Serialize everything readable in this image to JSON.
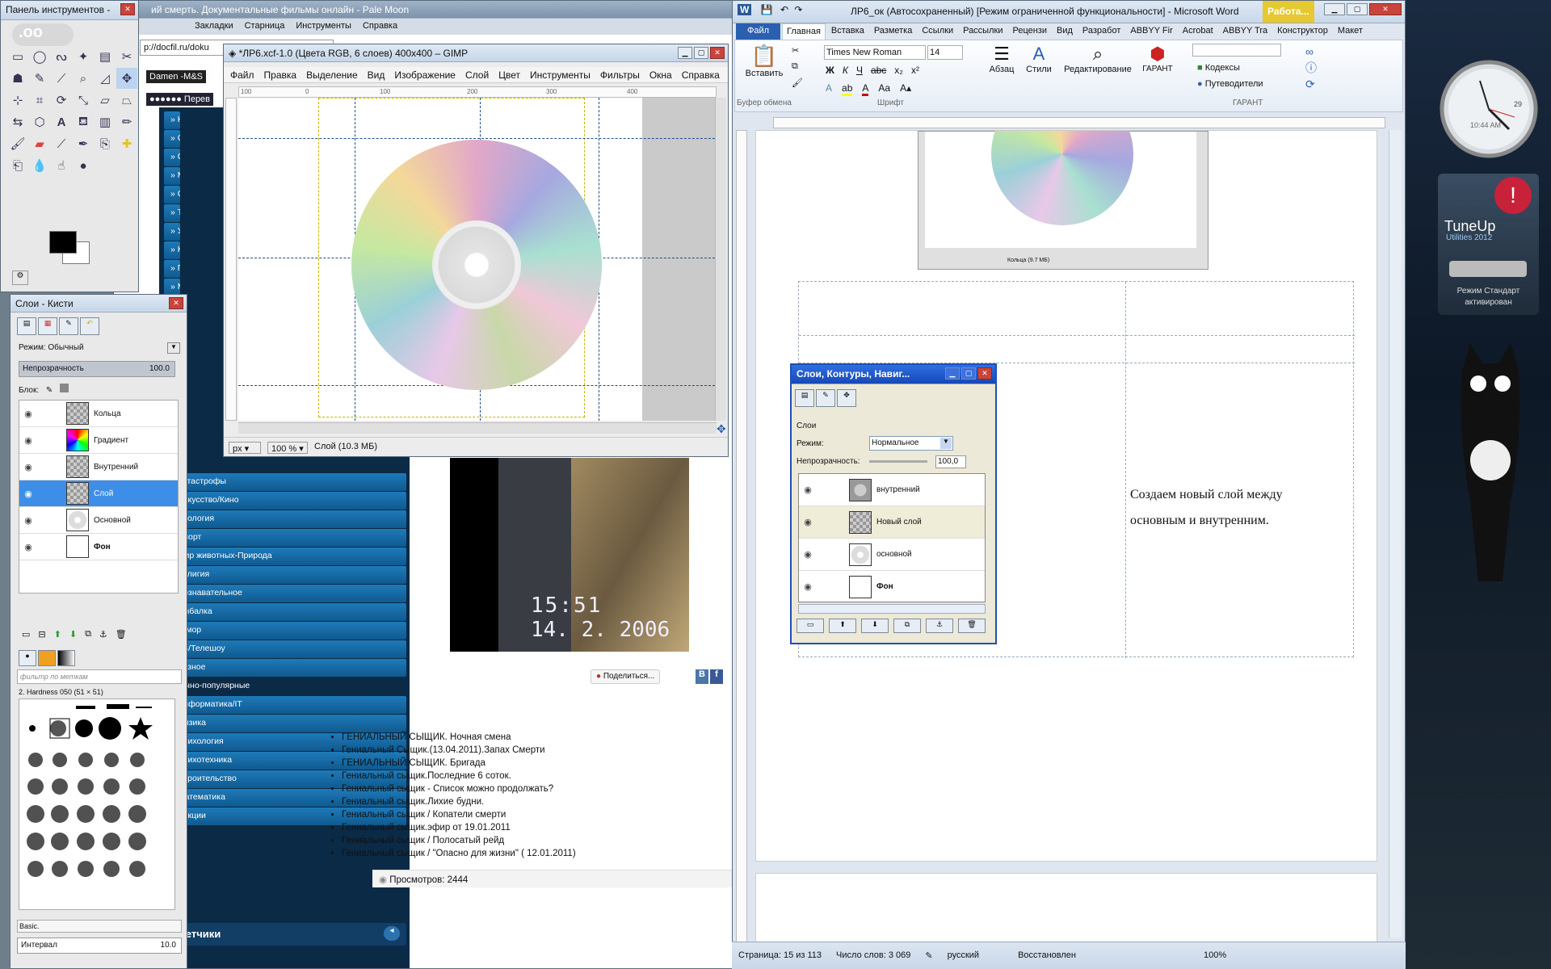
{
  "palemoon": {
    "title": "ий смерть. Документальные фильмы онлайн - Pale Moon",
    "menu": [
      "Закладки",
      "Старница",
      "Инструменты",
      "Справка"
    ],
    "url": "p://docfil.ru/doku",
    "tab1": "Damen -M&S",
    "tab2": "●●●●●● Перев",
    "sidebar_items": [
      "» Катастрофы",
      "» Искусство/Кино",
      "» Экология",
      "» Спорт",
      "» Мир животных-Природа",
      "» Религия",
      "» Познавательное",
      "» Рыбалка",
      "» Юмор",
      "» ТВ/Телешоу",
      "» Разное",
      "Научно-популярные",
      "» Информатика/IT",
      "» Физика",
      "» Психология",
      "» Психотехника",
      "» Строительство",
      "» Математика",
      "» Лекции"
    ],
    "sidebar_top_items": [
      "» Н",
      "» С",
      "» С",
      "» М",
      "» С",
      "» Т",
      "» У",
      "» К",
      "» П",
      "» М",
      "» П",
      "» А",
      "» П",
      "» Б",
      "» Р",
      "» Н",
      "» А",
      "» В"
    ],
    "counters_title": "Счетчики",
    "video_time": "15:51",
    "video_date": "14. 2. 2006",
    "share_label": "Поделиться...",
    "list_items": [
      "ГЕНИАЛЬНЫЙ СЫЩИК. Ночная смена",
      "Гениальный Сыщик.(13.04.2011).Запах Смерти",
      "ГЕНИАЛЬНЫЙ СЫЩИК. Бригада",
      "Гениальный сыщик.Последние 6 соток.",
      "Гениальный сыщик - Список можно продолжать?",
      "Гениальный сыщик.Лихие будни.",
      "Гениальный сыщик / Копатели смерти",
      "Гениальный сыщик.эфир от 19.01.2011",
      "Гениальный сыщик / Полосатый рейд",
      "Гениальный сыщик / \"Опасно для жизни\" ( 12.01.2011)"
    ],
    "views": "Просмотров: 2444"
  },
  "toolbox": {
    "title": "Панель инструментов -"
  },
  "layers_brushes": {
    "title": "Слои - Кисти",
    "mode_label": "Режим: Обычный",
    "opacity_label": "Непрозрачность",
    "opacity_value": "100.0",
    "lock_label": "Блок:",
    "layers": [
      {
        "name": "Кольца",
        "selected": false
      },
      {
        "name": "Градиент",
        "selected": false
      },
      {
        "name": "Внутренний",
        "selected": false
      },
      {
        "name": "Слой",
        "selected": true
      },
      {
        "name": "Основной",
        "selected": false
      },
      {
        "name": "Фон",
        "selected": false
      }
    ],
    "filter_placeholder": "фильтр по меткам",
    "brush_name": "2. Hardness 050 (51 × 51)",
    "preset": "Basic.",
    "spacing_label": "Интервал",
    "spacing_value": "10.0"
  },
  "gimp": {
    "title": "*ЛР6.xcf-1.0 (Цвета RGB, 6 слоев) 400x400 – GIMP",
    "menu": [
      "Файл",
      "Правка",
      "Выделение",
      "Вид",
      "Изображение",
      "Слой",
      "Цвет",
      "Инструменты",
      "Фильтры",
      "Окна",
      "Справка"
    ],
    "ruler_labels": [
      "100",
      "0",
      "100",
      "200",
      "300",
      "400"
    ],
    "unit": "px",
    "zoom": "100 %",
    "status": "Слой (10.3 МБ)"
  },
  "word": {
    "title": "ЛР6_ок (Автосохраненный) [Режим ограниченной функциональности] - Microsoft Word",
    "context_tab": "Работа...",
    "tabs": [
      "Файл",
      "Главная",
      "Вставка",
      "Разметка",
      "Ссылки",
      "Рассылки",
      "Рецензи",
      "Вид",
      "Разработ",
      "ABBYY Fir",
      "Acrobat",
      "ABBYY Tra",
      "Конструктор",
      "Макет"
    ],
    "active_tab": "Главная",
    "paste_label": "Вставить",
    "clipboard_label": "Буфер обмена",
    "font_name": "Times New Roman",
    "font_size": "14",
    "font_group_label": "Шрифт",
    "paragraph_label": "Абзац",
    "styles_label": "Стили",
    "editing_label": "Редактирование",
    "garant_label": "ГАРАНТ",
    "codex_label": "Кодексы",
    "guides_label": "Путеводители",
    "garant_group_label": "ГАРАНТ",
    "doc_text_line1": "Создаем новый слой между",
    "doc_text_line2": "основным и внутренним.",
    "mini_status": "Кольца (9.7 МБ)",
    "status_page": "Страница: 15 из 113",
    "status_words": "Число слов: 3 069",
    "status_lang": "русский",
    "status_restored": "Восстановлен",
    "zoom": "100%"
  },
  "layers_dialog": {
    "title": "Слои, Контуры, Навиг...",
    "section_label": "Слои",
    "mode_label": "Режим:",
    "mode_value": "Нормальное",
    "opacity_label": "Непрозрачность:",
    "opacity_value": "100,0",
    "layers": [
      "внутренний",
      "Новый слой",
      "основной",
      "Фон"
    ]
  },
  "clock": {
    "time": "10:44 AM",
    "day": "29"
  },
  "tuneup": {
    "title": "TuneUp",
    "subtitle": "Utilities 2012",
    "status1": "Режим Стандарт",
    "status2": "активирован"
  },
  "colors": {
    "accent": "#2b6cc4",
    "web_blue": "#11619a",
    "selection": "#3d8ee8"
  }
}
